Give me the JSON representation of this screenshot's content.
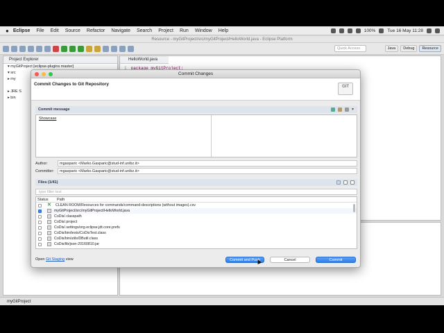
{
  "menubar": {
    "app": "Eclipse",
    "items": [
      "File",
      "Edit",
      "Source",
      "Refactor",
      "Navigate",
      "Search",
      "Project",
      "Run",
      "Window",
      "Help"
    ],
    "battery": "100%",
    "clock": "Tue 16 May 11:28"
  },
  "window": {
    "title": "Resource - myGitProject/src/myGitProject/HelloWorld.java - Eclipse Platform"
  },
  "toolbar": {
    "quick_access": "Quick Access",
    "perspectives": [
      "Java",
      "Debug",
      "Resource"
    ]
  },
  "project_explorer": {
    "tab": "Project Explorer",
    "rows": [
      "▾ myGitProject [eclipse-plugins master]",
      "  ▾ src",
      "     ▸ my",
      "",
      "  ▸ JRE S",
      "  ▸ bin"
    ]
  },
  "editor": {
    "tab": "HelloWorld.java",
    "line": "1",
    "code": "package myGitProject;"
  },
  "status": {
    "text": "myGitProject"
  },
  "dialog": {
    "title": "Commit Changes",
    "header": "Commit Changes to Git Repository",
    "git_logo": "GIT",
    "commit_message_label": "Commit message",
    "commit_message": "Showcase",
    "author_label": "Author:",
    "author": "mgasparic <Marko.Gasparic@stud-inf.unibz.it>",
    "committer_label": "Committer:",
    "committer": "mgasparic <Marko.Gasparic@stud-inf.unibz.it>",
    "files_label": "Files (1/41)",
    "filter_placeholder": "type filter text",
    "columns": [
      "Status",
      "Path"
    ],
    "files": [
      {
        "checked": false,
        "icon": "x",
        "path": "CLEAN ROOM/Resources for commands/command-descriptions (without images).csv"
      },
      {
        "checked": true,
        "icon": "file",
        "path": "myGitProject/src/myGitProject/HelloWorld.java"
      },
      {
        "checked": false,
        "icon": "file",
        "path": "CoDis/.classpath"
      },
      {
        "checked": false,
        "icon": "file",
        "path": "CoDis/.project"
      },
      {
        "checked": false,
        "icon": "file",
        "path": "CoDis/.settings/org.eclipse.jdt.core.prefs"
      },
      {
        "checked": false,
        "icon": "file",
        "path": "CoDis/bin/tests/CoDisTest.class"
      },
      {
        "checked": false,
        "icon": "file",
        "path": "CoDis/bin/utils/DButil.class"
      },
      {
        "checked": false,
        "icon": "file",
        "path": "CoDis/lib/json-20160810.jar"
      }
    ],
    "open_prefix": "Open",
    "open_link": "Git Staging",
    "open_suffix": "view",
    "btn_commit_push": "Commit and Push",
    "btn_cancel": "Cancel",
    "btn_commit": "Commit"
  }
}
